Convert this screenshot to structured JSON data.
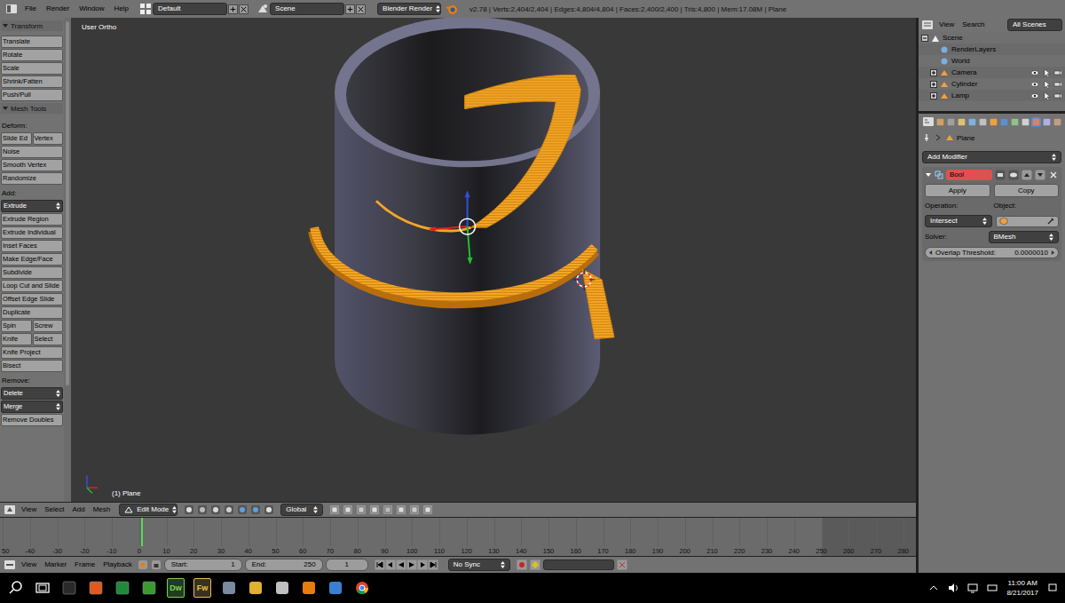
{
  "info_bar": {
    "menu": [
      "File",
      "Render",
      "Window",
      "Help"
    ],
    "layout": "Default",
    "scene": "Scene",
    "engine": "Blender Render",
    "stats": "v2.78 | Verts:2,404/2,404 | Edges:4,804/4,804 | Faces:2,400/2,400 | Tris:4,800 | Mem:17.08M | Plane"
  },
  "tool_shelf": [
    {
      "kind": "header",
      "labels": [
        "Transform"
      ]
    },
    {
      "kind": "button",
      "labels": [
        "Translate"
      ]
    },
    {
      "kind": "button",
      "labels": [
        "Rotate"
      ]
    },
    {
      "kind": "button",
      "labels": [
        "Scale"
      ]
    },
    {
      "kind": "button",
      "labels": [
        "Shrink/Fatten"
      ]
    },
    {
      "kind": "button",
      "labels": [
        "Push/Pull"
      ]
    },
    {
      "kind": "header",
      "labels": [
        "Mesh Tools"
      ]
    },
    {
      "kind": "label",
      "labels": [
        "Deform:"
      ]
    },
    {
      "kind": "button",
      "labels": [
        "Slide Ed",
        "Vertex"
      ]
    },
    {
      "kind": "button",
      "labels": [
        "Noise"
      ]
    },
    {
      "kind": "button",
      "labels": [
        "Smooth Vertex"
      ]
    },
    {
      "kind": "button",
      "labels": [
        "Randomize"
      ]
    },
    {
      "kind": "label",
      "labels": [
        "Add:"
      ]
    },
    {
      "kind": "dropdown",
      "labels": [
        "Extrude"
      ]
    },
    {
      "kind": "button",
      "labels": [
        "Extrude Region"
      ]
    },
    {
      "kind": "button",
      "labels": [
        "Extrude Individual"
      ]
    },
    {
      "kind": "button",
      "labels": [
        "Inset Faces"
      ]
    },
    {
      "kind": "button",
      "labels": [
        "Make Edge/Face"
      ]
    },
    {
      "kind": "button",
      "labels": [
        "Subdivide"
      ]
    },
    {
      "kind": "button",
      "labels": [
        "Loop Cut and Slide"
      ]
    },
    {
      "kind": "button",
      "labels": [
        "Offset Edge Slide"
      ]
    },
    {
      "kind": "button",
      "labels": [
        "Duplicate"
      ]
    },
    {
      "kind": "button",
      "labels": [
        "Spin",
        "Screw"
      ]
    },
    {
      "kind": "button",
      "labels": [
        "Knife",
        "Select"
      ]
    },
    {
      "kind": "button",
      "labels": [
        "Knife Project"
      ]
    },
    {
      "kind": "button",
      "labels": [
        "Bisect"
      ]
    },
    {
      "kind": "label",
      "labels": [
        "Remove:"
      ]
    },
    {
      "kind": "dropdown",
      "labels": [
        "Delete"
      ]
    },
    {
      "kind": "dropdown",
      "labels": [
        "Merge"
      ]
    },
    {
      "kind": "button",
      "labels": [
        "Remove Doubles"
      ]
    }
  ],
  "viewport": {
    "view": "User Ortho",
    "object": "(1) Plane"
  },
  "viewport_header": {
    "menu": [
      "View",
      "Select",
      "Add",
      "Mesh"
    ],
    "mode": "Edit Mode",
    "orientation": "Global"
  },
  "timeline": {
    "ruler": [
      "50",
      "-40",
      "-30",
      "-20",
      "-10",
      "0",
      "10",
      "20",
      "30",
      "40",
      "50",
      "60",
      "70",
      "80",
      "90",
      "100",
      "110",
      "120",
      "130",
      "140",
      "150",
      "160",
      "170",
      "180",
      "190",
      "200",
      "210",
      "220",
      "230",
      "240",
      "250",
      "260",
      "270",
      "280"
    ]
  },
  "timeline_header": {
    "menu": [
      "View",
      "Marker",
      "Frame",
      "Playback"
    ],
    "start_label": "Start:",
    "start": "1",
    "end_label": "End:",
    "end": "250",
    "current": "1",
    "sync": "No Sync"
  },
  "outliner": {
    "menu": [
      "View",
      "Search"
    ],
    "filter": "All Scenes",
    "tree": [
      {
        "label": "Scene",
        "kind": "scene",
        "expanded": true,
        "children": [
          {
            "label": "RenderLayers",
            "kind": "data"
          },
          {
            "label": "World",
            "kind": "data"
          },
          {
            "label": "Camera",
            "kind": "object",
            "expanded": false
          },
          {
            "label": "Cylinder",
            "kind": "object",
            "expanded": false
          },
          {
            "label": "Lamp",
            "kind": "object",
            "expanded": false
          }
        ]
      }
    ]
  },
  "properties": {
    "context": "Plane",
    "add_modifier": "Add Modifier",
    "modifier": {
      "name": "Bool",
      "invalid": true,
      "expanded": true,
      "apply": "Apply",
      "copy": "Copy",
      "operation_label": "Operation:",
      "operation": "Intersect",
      "object_label": "Object:",
      "solver_label": "Solver:",
      "solver": "BMesh",
      "threshold_label": "Overlap Threshold:",
      "threshold": "0.0000010"
    }
  },
  "taskbar": {
    "pinned": [
      "Dw",
      "Fw"
    ],
    "time": "11:00 AM",
    "date": "8/21/2017"
  }
}
